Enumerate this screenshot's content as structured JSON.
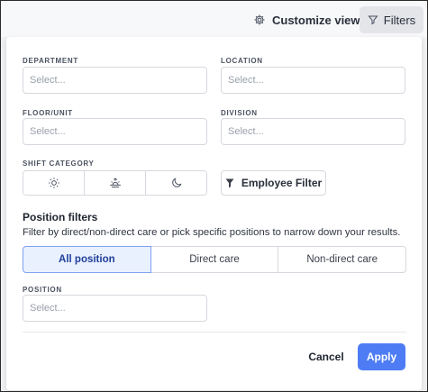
{
  "header": {
    "customize_label": "Customize view",
    "filters_label": "Filters"
  },
  "fields": {
    "department": {
      "label": "DEPARTMENT",
      "placeholder": "Select..."
    },
    "location": {
      "label": "LOCATION",
      "placeholder": "Select..."
    },
    "floor_unit": {
      "label": "FLOOR/UNIT",
      "placeholder": "Select..."
    },
    "division": {
      "label": "DIVISION",
      "placeholder": "Select..."
    },
    "shift_category": {
      "label": "SHIFT CATEGORY",
      "options": [
        "sun-icon",
        "sunrise-icon",
        "moon-icon"
      ]
    },
    "position": {
      "label": "POSITION",
      "placeholder": "Select..."
    }
  },
  "employee_filter_label": "Employee Filter",
  "position_filters": {
    "title": "Position filters",
    "description": "Filter by direct/non-direct care or pick specific positions to narrow down your results.",
    "options": [
      "All position",
      "Direct care",
      "Non-direct care"
    ],
    "selected": "All position"
  },
  "footer": {
    "cancel_label": "Cancel",
    "apply_label": "Apply"
  },
  "colors": {
    "accent": "#4d7cf4",
    "selected_bg": "#e9f0fe",
    "selected_border": "#7ea2f2"
  }
}
